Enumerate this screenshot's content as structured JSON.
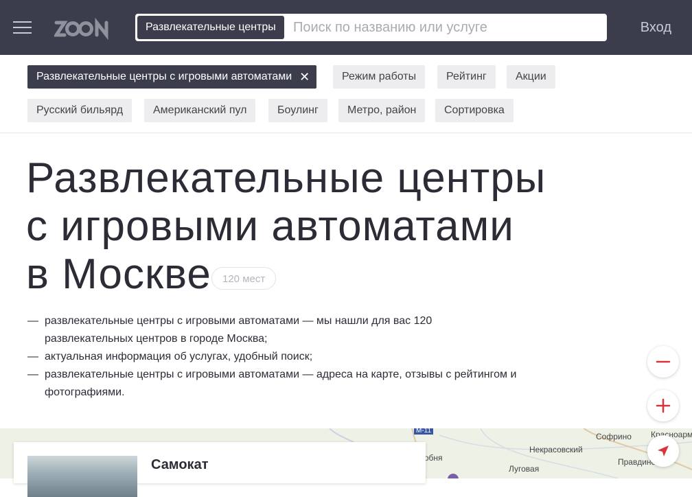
{
  "header": {
    "logo_text": "ZOON",
    "search": {
      "category_chip": "Развлекательные центры",
      "placeholder": "Поиск по названию или услуге",
      "value": ""
    },
    "login_label": "Вход"
  },
  "filters": {
    "active_filter": "Развлекательные центры с игровыми автоматами",
    "chips_row1": [
      "Режим работы",
      "Рейтинг",
      "Акции"
    ],
    "chips_row2": [
      "Русский бильярд",
      "Американский пул",
      "Боулинг",
      "Метро, район",
      "Сортировка"
    ]
  },
  "page": {
    "title_line1": "Развлекательные центры",
    "title_line2": "с игровыми автоматами",
    "title_line3": "в Москве",
    "count_badge": "120 мест",
    "description": [
      "развлекательные центры с игровыми автоматами — мы нашли для вас 120 развлекательных центров в городе Москва;",
      "актуальная информация об услугах, удобный поиск;",
      "развлекательные центры с игровыми автоматами — адреса на карте, отзывы с рейтингом и фотографиями."
    ]
  },
  "map": {
    "labels": [
      "Софрино",
      "Красноармейск",
      "Некрасовский",
      "Правдинский",
      "Луговая",
      "Лобня",
      "М-11"
    ],
    "zoom_out_icon": "minus-icon",
    "zoom_in_icon": "plus-icon",
    "locate_icon": "navigation-arrow-icon"
  },
  "result_card": {
    "name": "Самокат"
  },
  "colors": {
    "header_bg": "#3b3d4c",
    "chip_bg": "#ededf0",
    "accent": "#d9323d",
    "map_bg": "#eef1e6"
  }
}
